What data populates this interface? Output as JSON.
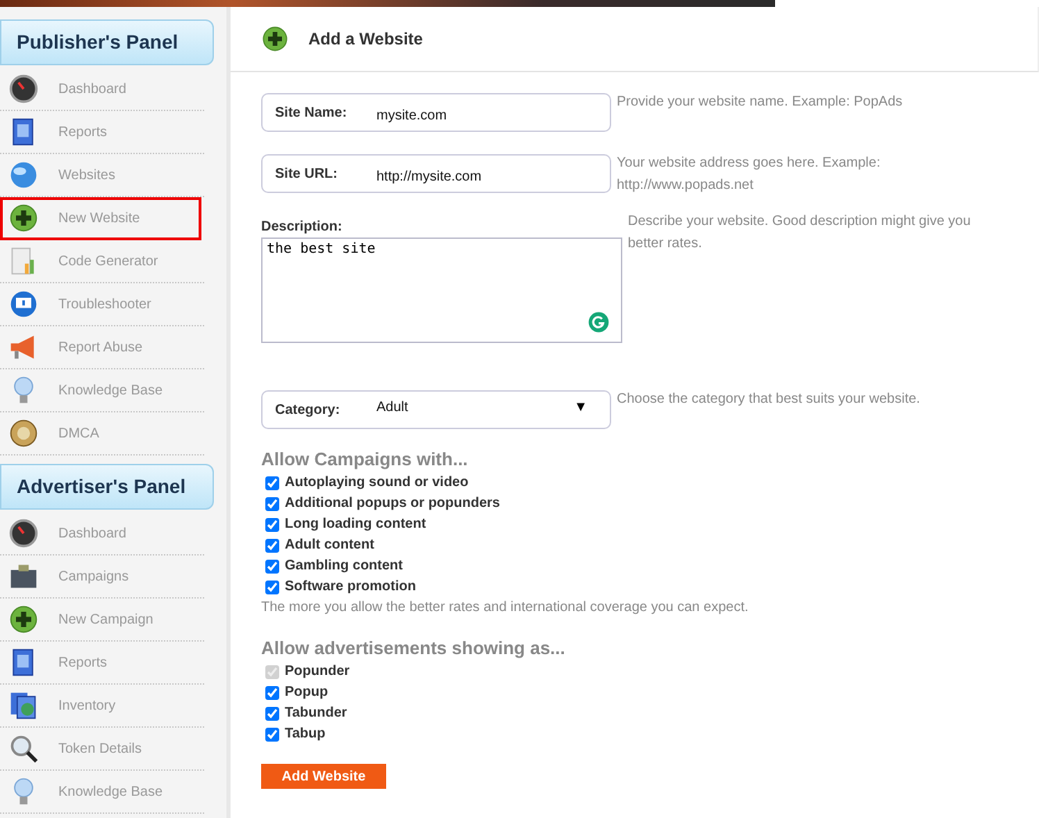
{
  "sidebar": {
    "panels": [
      {
        "title": "Publisher's Panel",
        "items": [
          {
            "label": "Dashboard",
            "kind": "gauge",
            "highlighted": false
          },
          {
            "label": "Reports",
            "kind": "report",
            "highlighted": false
          },
          {
            "label": "Websites",
            "kind": "globe",
            "highlighted": false
          },
          {
            "label": "New Website",
            "kind": "plus",
            "highlighted": true
          },
          {
            "label": "Code Generator",
            "kind": "code",
            "highlighted": false
          },
          {
            "label": "Troubleshooter",
            "kind": "monitor",
            "highlighted": false
          },
          {
            "label": "Report Abuse",
            "kind": "megaphone",
            "highlighted": false
          },
          {
            "label": "Knowledge Base",
            "kind": "bulb",
            "highlighted": false
          },
          {
            "label": "DMCA",
            "kind": "seal",
            "highlighted": false
          }
        ]
      },
      {
        "title": "Advertiser's Panel",
        "items": [
          {
            "label": "Dashboard",
            "kind": "gauge",
            "highlighted": false
          },
          {
            "label": "Campaigns",
            "kind": "wallet",
            "highlighted": false
          },
          {
            "label": "New Campaign",
            "kind": "plus",
            "highlighted": false
          },
          {
            "label": "Reports",
            "kind": "report",
            "highlighted": false
          },
          {
            "label": "Inventory",
            "kind": "inventory",
            "highlighted": false
          },
          {
            "label": "Token Details",
            "kind": "magnifier",
            "highlighted": false
          },
          {
            "label": "Knowledge Base",
            "kind": "bulb",
            "highlighted": false
          }
        ]
      }
    ]
  },
  "main": {
    "title": "Add a Website",
    "site_name": {
      "label": "Site Name:",
      "value": "mysite.com",
      "help": "Provide your website name. Example: PopAds"
    },
    "site_url": {
      "label": "Site URL:",
      "value": "http://mysite.com",
      "help_lines": [
        "Your website address goes here. Example:",
        "http://www.popads.net"
      ]
    },
    "description": {
      "label": "Description:",
      "value": "the best site",
      "help_lines": [
        "Describe your website. Good description might give you",
        "better rates."
      ]
    },
    "category": {
      "label": "Category:",
      "value": "Adult",
      "arrow": "▼",
      "help": "Choose the category that best suits your website."
    },
    "campaigns": {
      "heading": "Allow Campaigns with...",
      "options": [
        {
          "label": "Autoplaying sound or video",
          "checked": true,
          "disabled": false
        },
        {
          "label": "Additional popups or popunders",
          "checked": true,
          "disabled": false
        },
        {
          "label": "Long loading content",
          "checked": true,
          "disabled": false
        },
        {
          "label": "Adult content",
          "checked": true,
          "disabled": false
        },
        {
          "label": "Gambling content",
          "checked": true,
          "disabled": false
        },
        {
          "label": "Software promotion",
          "checked": true,
          "disabled": false
        }
      ],
      "note": "The more you allow the better rates and international coverage you can expect."
    },
    "formats": {
      "heading": "Allow advertisements showing as...",
      "options": [
        {
          "label": "Popunder",
          "checked": true,
          "disabled": true
        },
        {
          "label": "Popup",
          "checked": true,
          "disabled": false
        },
        {
          "label": "Tabunder",
          "checked": true,
          "disabled": false
        },
        {
          "label": "Tabup",
          "checked": true,
          "disabled": false
        }
      ]
    },
    "submit": "Add Website"
  }
}
